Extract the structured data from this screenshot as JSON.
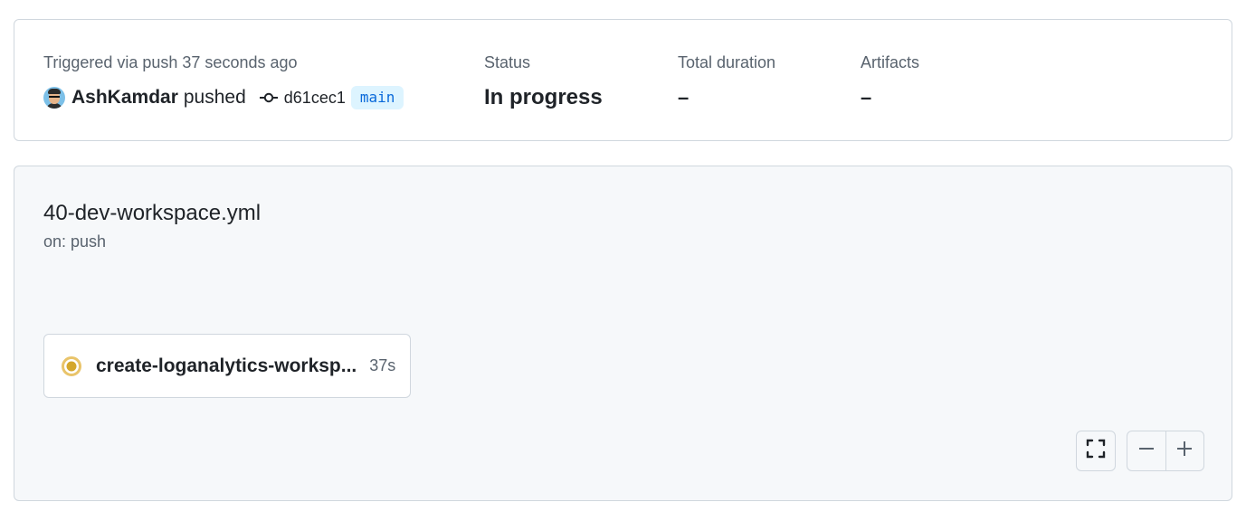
{
  "summary": {
    "trigger_label": "Triggered via push 37 seconds ago",
    "actor": "AshKamdar",
    "action": "pushed",
    "commit_sha": "d61cec1",
    "branch": "main",
    "status_label": "Status",
    "status_value": "In progress",
    "duration_label": "Total duration",
    "duration_value": "–",
    "artifacts_label": "Artifacts",
    "artifacts_value": "–"
  },
  "workflow": {
    "title": "40-dev-workspace.yml",
    "trigger": "on: push",
    "jobs": [
      {
        "name": "create-loganalytics-worksp...",
        "duration": "37s",
        "status": "in-progress",
        "status_color": "#bf8700"
      }
    ]
  },
  "controls": {
    "fullscreen_icon": "fullscreen-icon",
    "zoom_out_icon": "minus-icon",
    "zoom_in_icon": "plus-icon"
  },
  "colors": {
    "accent": "#0969da",
    "branch_bg": "#ddf4ff",
    "in_progress": "#bf8700",
    "muted": "#59636e"
  }
}
